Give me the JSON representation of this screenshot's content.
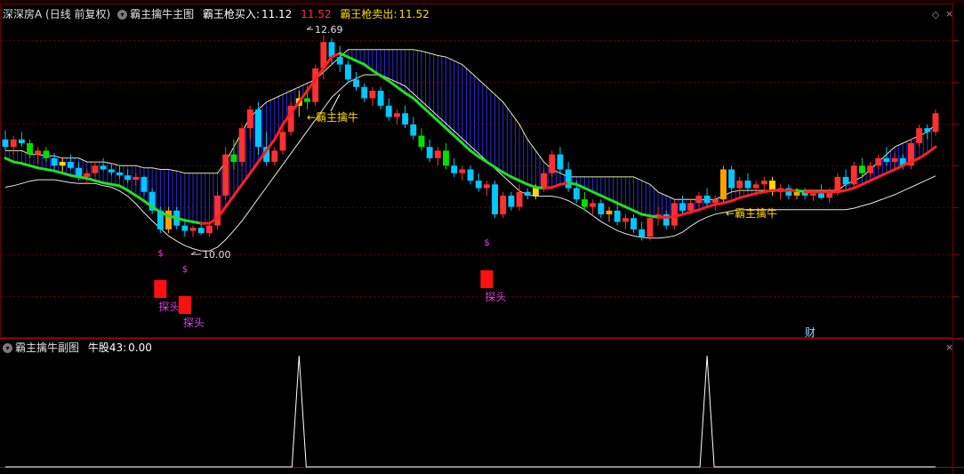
{
  "header": {
    "stock_name": "深深房A",
    "period": "(日线 前复权)",
    "indicator_main": "霸主擒牛主图",
    "buy_label": "霸王枪买入:",
    "buy_value": "11.12",
    "buy_value2": "11.52",
    "sell_label": "霸王枪卖出:",
    "sell_value": "11.52"
  },
  "sub": {
    "indicator": "霸主擒牛副图",
    "label": "牛股43:",
    "value": "0.00"
  },
  "annotations": {
    "high": "12.69",
    "low": "10.00",
    "bull1": "←霸主擒牛",
    "bull2": "←霸主擒牛",
    "probe": "探头",
    "dollar": "$",
    "cai": "财"
  },
  "colors": {
    "up": "#ff3030",
    "down": "#00c8ff",
    "green": "#00e000",
    "yellow": "#ffd700",
    "orange": "#ffa000",
    "magenta": "#e040e0",
    "band": "#3030ff",
    "grid": "#5a0000"
  },
  "chart_data": {
    "type": "candlestick",
    "ylim": [
      9.6,
      12.9
    ],
    "high_mark": 12.69,
    "low_mark": 10.0,
    "buy_price": 11.12,
    "sell_price": 11.52,
    "candles": [
      {
        "o": 11.3,
        "h": 11.42,
        "l": 11.15,
        "c": 11.2
      },
      {
        "o": 11.2,
        "h": 11.35,
        "l": 11.1,
        "c": 11.3
      },
      {
        "o": 11.3,
        "h": 11.4,
        "l": 11.2,
        "c": 11.25
      },
      {
        "o": 11.25,
        "h": 11.3,
        "l": 11.05,
        "c": 11.1
      },
      {
        "o": 11.1,
        "h": 11.2,
        "l": 10.98,
        "c": 11.15
      },
      {
        "o": 11.15,
        "h": 11.2,
        "l": 11.0,
        "c": 11.05
      },
      {
        "o": 11.05,
        "h": 11.12,
        "l": 10.9,
        "c": 10.95
      },
      {
        "o": 10.95,
        "h": 11.05,
        "l": 10.85,
        "c": 11.0
      },
      {
        "o": 11.0,
        "h": 11.1,
        "l": 10.9,
        "c": 10.92
      },
      {
        "o": 10.92,
        "h": 11.0,
        "l": 10.75,
        "c": 10.8
      },
      {
        "o": 10.8,
        "h": 10.9,
        "l": 10.7,
        "c": 10.85
      },
      {
        "o": 10.85,
        "h": 11.0,
        "l": 10.8,
        "c": 10.95
      },
      {
        "o": 10.95,
        "h": 11.05,
        "l": 10.88,
        "c": 10.9
      },
      {
        "o": 10.9,
        "h": 10.98,
        "l": 10.82,
        "c": 10.86
      },
      {
        "o": 10.86,
        "h": 10.95,
        "l": 10.78,
        "c": 10.82
      },
      {
        "o": 10.82,
        "h": 10.9,
        "l": 10.72,
        "c": 10.76
      },
      {
        "o": 10.76,
        "h": 10.85,
        "l": 10.68,
        "c": 10.8
      },
      {
        "o": 10.8,
        "h": 10.82,
        "l": 10.55,
        "c": 10.6
      },
      {
        "o": 10.6,
        "h": 10.65,
        "l": 10.3,
        "c": 10.35
      },
      {
        "o": 10.35,
        "h": 10.4,
        "l": 10.05,
        "c": 10.1
      },
      {
        "o": 10.1,
        "h": 10.4,
        "l": 10.05,
        "c": 10.35
      },
      {
        "o": 10.35,
        "h": 10.4,
        "l": 10.1,
        "c": 10.15
      },
      {
        "o": 10.15,
        "h": 10.2,
        "l": 10.0,
        "c": 10.08
      },
      {
        "o": 10.08,
        "h": 10.15,
        "l": 10.0,
        "c": 10.12
      },
      {
        "o": 10.12,
        "h": 10.2,
        "l": 10.02,
        "c": 10.05
      },
      {
        "o": 10.05,
        "h": 10.18,
        "l": 10.0,
        "c": 10.15
      },
      {
        "o": 10.15,
        "h": 10.6,
        "l": 10.1,
        "c": 10.55
      },
      {
        "o": 10.55,
        "h": 11.2,
        "l": 10.5,
        "c": 11.1
      },
      {
        "o": 11.1,
        "h": 11.3,
        "l": 10.9,
        "c": 11.0
      },
      {
        "o": 11.0,
        "h": 11.5,
        "l": 10.95,
        "c": 11.45
      },
      {
        "o": 11.45,
        "h": 11.75,
        "l": 11.3,
        "c": 11.7
      },
      {
        "o": 11.7,
        "h": 11.8,
        "l": 11.1,
        "c": 11.2
      },
      {
        "o": 11.2,
        "h": 11.4,
        "l": 10.95,
        "c": 11.0
      },
      {
        "o": 11.0,
        "h": 11.2,
        "l": 10.95,
        "c": 11.15
      },
      {
        "o": 11.15,
        "h": 11.5,
        "l": 11.1,
        "c": 11.4
      },
      {
        "o": 11.4,
        "h": 11.8,
        "l": 11.35,
        "c": 11.75
      },
      {
        "o": 11.75,
        "h": 11.95,
        "l": 11.6,
        "c": 11.85
      },
      {
        "o": 11.85,
        "h": 12.0,
        "l": 11.7,
        "c": 11.8
      },
      {
        "o": 11.8,
        "h": 12.3,
        "l": 11.75,
        "c": 12.25
      },
      {
        "o": 12.25,
        "h": 12.69,
        "l": 12.1,
        "c": 12.6
      },
      {
        "o": 12.6,
        "h": 12.65,
        "l": 12.3,
        "c": 12.4
      },
      {
        "o": 12.4,
        "h": 12.55,
        "l": 12.2,
        "c": 12.3
      },
      {
        "o": 12.3,
        "h": 12.35,
        "l": 12.05,
        "c": 12.1
      },
      {
        "o": 12.1,
        "h": 12.2,
        "l": 11.95,
        "c": 12.0
      },
      {
        "o": 12.0,
        "h": 12.05,
        "l": 11.8,
        "c": 11.85
      },
      {
        "o": 11.85,
        "h": 12.0,
        "l": 11.75,
        "c": 11.95
      },
      {
        "o": 11.95,
        "h": 12.0,
        "l": 11.7,
        "c": 11.75
      },
      {
        "o": 11.75,
        "h": 11.85,
        "l": 11.55,
        "c": 11.6
      },
      {
        "o": 11.6,
        "h": 11.7,
        "l": 11.5,
        "c": 11.65
      },
      {
        "o": 11.65,
        "h": 11.75,
        "l": 11.45,
        "c": 11.5
      },
      {
        "o": 11.5,
        "h": 11.6,
        "l": 11.3,
        "c": 11.35
      },
      {
        "o": 11.35,
        "h": 11.45,
        "l": 11.15,
        "c": 11.2
      },
      {
        "o": 11.2,
        "h": 11.3,
        "l": 11.0,
        "c": 11.05
      },
      {
        "o": 11.05,
        "h": 11.2,
        "l": 10.95,
        "c": 11.15
      },
      {
        "o": 11.15,
        "h": 11.25,
        "l": 10.9,
        "c": 10.95
      },
      {
        "o": 10.95,
        "h": 11.05,
        "l": 10.8,
        "c": 10.85
      },
      {
        "o": 10.85,
        "h": 10.95,
        "l": 10.75,
        "c": 10.9
      },
      {
        "o": 10.9,
        "h": 10.95,
        "l": 10.7,
        "c": 10.75
      },
      {
        "o": 10.75,
        "h": 10.85,
        "l": 10.6,
        "c": 10.65
      },
      {
        "o": 10.65,
        "h": 10.75,
        "l": 10.55,
        "c": 10.7
      },
      {
        "o": 10.7,
        "h": 10.75,
        "l": 10.25,
        "c": 10.3
      },
      {
        "o": 10.3,
        "h": 10.6,
        "l": 10.25,
        "c": 10.55
      },
      {
        "o": 10.55,
        "h": 10.6,
        "l": 10.35,
        "c": 10.4
      },
      {
        "o": 10.4,
        "h": 10.7,
        "l": 10.35,
        "c": 10.6
      },
      {
        "o": 10.6,
        "h": 10.65,
        "l": 10.5,
        "c": 10.55
      },
      {
        "o": 10.55,
        "h": 10.7,
        "l": 10.5,
        "c": 10.65
      },
      {
        "o": 10.65,
        "h": 10.9,
        "l": 10.6,
        "c": 10.85
      },
      {
        "o": 10.85,
        "h": 11.15,
        "l": 10.8,
        "c": 11.1
      },
      {
        "o": 11.1,
        "h": 11.2,
        "l": 10.85,
        "c": 10.9
      },
      {
        "o": 10.9,
        "h": 11.0,
        "l": 10.6,
        "c": 10.65
      },
      {
        "o": 10.65,
        "h": 10.75,
        "l": 10.45,
        "c": 10.5
      },
      {
        "o": 10.5,
        "h": 10.6,
        "l": 10.35,
        "c": 10.4
      },
      {
        "o": 10.4,
        "h": 10.5,
        "l": 10.3,
        "c": 10.45
      },
      {
        "o": 10.45,
        "h": 10.5,
        "l": 10.25,
        "c": 10.3
      },
      {
        "o": 10.3,
        "h": 10.4,
        "l": 10.2,
        "c": 10.35
      },
      {
        "o": 10.35,
        "h": 10.45,
        "l": 10.15,
        "c": 10.2
      },
      {
        "o": 10.2,
        "h": 10.3,
        "l": 10.1,
        "c": 10.25
      },
      {
        "o": 10.25,
        "h": 10.3,
        "l": 10.05,
        "c": 10.1
      },
      {
        "o": 10.1,
        "h": 10.2,
        "l": 9.95,
        "c": 10.0
      },
      {
        "o": 10.0,
        "h": 10.3,
        "l": 9.95,
        "c": 10.25
      },
      {
        "o": 10.25,
        "h": 10.4,
        "l": 10.15,
        "c": 10.3
      },
      {
        "o": 10.3,
        "h": 10.35,
        "l": 10.1,
        "c": 10.15
      },
      {
        "o": 10.15,
        "h": 10.5,
        "l": 10.1,
        "c": 10.45
      },
      {
        "o": 10.45,
        "h": 10.55,
        "l": 10.3,
        "c": 10.35
      },
      {
        "o": 10.35,
        "h": 10.5,
        "l": 10.3,
        "c": 10.45
      },
      {
        "o": 10.45,
        "h": 10.6,
        "l": 10.4,
        "c": 10.55
      },
      {
        "o": 10.55,
        "h": 10.65,
        "l": 10.4,
        "c": 10.45
      },
      {
        "o": 10.45,
        "h": 10.55,
        "l": 10.35,
        "c": 10.5
      },
      {
        "o": 10.5,
        "h": 10.95,
        "l": 10.45,
        "c": 10.9
      },
      {
        "o": 10.9,
        "h": 10.95,
        "l": 10.6,
        "c": 10.65
      },
      {
        "o": 10.65,
        "h": 10.8,
        "l": 10.55,
        "c": 10.75
      },
      {
        "o": 10.75,
        "h": 10.85,
        "l": 10.6,
        "c": 10.65
      },
      {
        "o": 10.65,
        "h": 10.75,
        "l": 10.55,
        "c": 10.7
      },
      {
        "o": 10.7,
        "h": 10.8,
        "l": 10.6,
        "c": 10.75
      },
      {
        "o": 10.75,
        "h": 10.8,
        "l": 10.55,
        "c": 10.6
      },
      {
        "o": 10.6,
        "h": 10.7,
        "l": 10.5,
        "c": 10.65
      },
      {
        "o": 10.65,
        "h": 10.7,
        "l": 10.5,
        "c": 10.55
      },
      {
        "o": 10.55,
        "h": 10.65,
        "l": 10.5,
        "c": 10.6
      },
      {
        "o": 10.6,
        "h": 10.65,
        "l": 10.5,
        "c": 10.55
      },
      {
        "o": 10.55,
        "h": 10.62,
        "l": 10.48,
        "c": 10.58
      },
      {
        "o": 10.58,
        "h": 10.7,
        "l": 10.5,
        "c": 10.52
      },
      {
        "o": 10.52,
        "h": 10.65,
        "l": 10.45,
        "c": 10.6
      },
      {
        "o": 10.6,
        "h": 10.85,
        "l": 10.55,
        "c": 10.8
      },
      {
        "o": 10.8,
        "h": 10.9,
        "l": 10.65,
        "c": 10.7
      },
      {
        "o": 10.7,
        "h": 11.0,
        "l": 10.65,
        "c": 10.95
      },
      {
        "o": 10.95,
        "h": 11.05,
        "l": 10.8,
        "c": 10.85
      },
      {
        "o": 10.85,
        "h": 11.0,
        "l": 10.8,
        "c": 10.95
      },
      {
        "o": 10.95,
        "h": 11.1,
        "l": 10.9,
        "c": 11.05
      },
      {
        "o": 11.05,
        "h": 11.2,
        "l": 10.95,
        "c": 11.0
      },
      {
        "o": 11.0,
        "h": 11.12,
        "l": 10.9,
        "c": 11.05
      },
      {
        "o": 11.05,
        "h": 11.1,
        "l": 10.9,
        "c": 10.95
      },
      {
        "o": 10.95,
        "h": 11.3,
        "l": 10.9,
        "c": 11.25
      },
      {
        "o": 11.25,
        "h": 11.5,
        "l": 11.2,
        "c": 11.45
      },
      {
        "o": 11.45,
        "h": 11.5,
        "l": 11.3,
        "c": 11.4
      },
      {
        "o": 11.4,
        "h": 11.7,
        "l": 11.35,
        "c": 11.65
      }
    ],
    "band_upper": [
      11.15,
      11.15,
      11.15,
      11.1,
      11.1,
      11.08,
      11.08,
      11.05,
      11.05,
      11.05,
      11.0,
      11.0,
      11.0,
      10.98,
      10.95,
      10.95,
      10.95,
      10.92,
      10.92,
      10.9,
      10.9,
      10.88,
      10.85,
      10.85,
      10.85,
      10.85,
      10.85,
      11.0,
      11.2,
      11.4,
      11.6,
      11.7,
      11.8,
      11.85,
      11.9,
      11.95,
      12.0,
      12.05,
      12.1,
      12.2,
      12.3,
      12.4,
      12.5,
      12.5,
      12.5,
      12.5,
      12.5,
      12.5,
      12.5,
      12.5,
      12.5,
      12.48,
      12.45,
      12.42,
      12.4,
      12.35,
      12.3,
      12.2,
      12.1,
      12.0,
      11.9,
      11.8,
      11.65,
      11.5,
      11.3,
      11.15,
      11.0,
      10.9,
      10.85,
      10.8,
      10.8,
      10.8,
      10.8,
      10.8,
      10.8,
      10.8,
      10.8,
      10.8,
      10.75,
      10.7,
      10.6,
      10.55,
      10.5,
      10.5,
      10.5,
      10.5,
      10.5,
      10.5,
      10.55,
      10.6,
      10.62,
      10.62,
      10.62,
      10.62,
      10.62,
      10.62,
      10.62,
      10.62,
      10.62,
      10.62,
      10.62,
      10.62,
      10.62,
      10.7,
      10.75,
      10.8,
      10.9,
      11.0,
      11.1,
      11.2,
      11.25,
      11.3,
      11.35,
      11.4,
      11.5
    ],
    "band_lower": [
      11.05,
      11.0,
      10.98,
      10.95,
      10.92,
      10.9,
      10.88,
      10.85,
      10.82,
      10.8,
      10.78,
      10.75,
      10.72,
      10.7,
      10.68,
      10.62,
      10.55,
      10.48,
      10.4,
      10.33,
      10.28,
      10.25,
      10.22,
      10.2,
      10.18,
      10.18,
      10.25,
      10.4,
      10.55,
      10.7,
      10.85,
      11.0,
      11.15,
      11.3,
      11.5,
      11.65,
      11.8,
      11.95,
      12.1,
      12.25,
      12.4,
      12.45,
      12.4,
      12.35,
      12.3,
      12.22,
      12.15,
      12.08,
      12.0,
      11.92,
      11.85,
      11.75,
      11.65,
      11.55,
      11.45,
      11.35,
      11.25,
      11.15,
      11.07,
      11.0,
      10.93,
      10.86,
      10.8,
      10.75,
      10.7,
      10.66,
      10.65,
      10.66,
      10.7,
      10.72,
      10.7,
      10.65,
      10.6,
      10.55,
      10.5,
      10.45,
      10.4,
      10.35,
      10.3,
      10.28,
      10.26,
      10.26,
      10.27,
      10.3,
      10.33,
      10.36,
      10.4,
      10.43,
      10.45,
      10.48,
      10.52,
      10.55,
      10.58,
      10.6,
      10.62,
      10.62,
      10.62,
      10.62,
      10.6,
      10.6,
      10.6,
      10.6,
      10.6,
      10.62,
      10.65,
      10.7,
      10.75,
      10.8,
      10.85,
      10.9,
      10.95,
      11.0,
      11.05,
      11.12,
      11.2
    ],
    "slow_line": [
      10.9,
      10.92,
      10.95,
      10.98,
      11.0,
      11.0,
      11.0,
      10.98,
      10.96,
      10.95,
      10.95,
      10.95,
      10.92,
      10.9,
      10.85,
      10.78,
      10.68,
      10.56,
      10.45,
      10.35,
      10.25,
      10.18,
      10.12,
      10.08,
      10.05,
      10.05,
      10.1,
      10.2,
      10.32,
      10.45,
      10.6,
      10.75,
      10.9,
      11.05,
      11.2,
      11.35,
      11.5,
      11.65,
      11.8,
      11.95,
      12.1,
      12.2,
      12.3,
      12.35,
      12.4,
      12.4,
      12.4,
      12.35,
      12.3,
      12.25,
      12.15,
      12.05,
      11.95,
      11.85,
      11.75,
      11.65,
      11.55,
      11.45,
      11.35,
      11.25,
      11.15,
      11.05,
      10.95,
      10.85,
      10.8,
      10.78,
      10.78,
      10.78,
      10.76,
      10.72,
      10.66,
      10.6,
      10.52,
      10.44,
      10.38,
      10.32,
      10.28,
      10.25,
      10.23,
      10.22,
      10.22,
      10.23,
      10.25,
      10.3,
      10.38,
      10.45,
      10.5,
      10.54,
      10.56,
      10.58,
      10.6,
      10.6,
      10.6,
      10.6,
      10.6,
      10.6,
      10.6,
      10.6,
      10.6,
      10.6,
      10.6,
      10.6,
      10.6,
      10.6,
      10.62,
      10.65,
      10.68,
      10.72,
      10.76,
      10.8,
      10.85,
      10.9,
      10.95,
      11.0,
      11.05
    ],
    "probe_index": [
      19,
      22,
      59
    ],
    "dollar_index": [
      19,
      22,
      59
    ],
    "sub_signal_index": [
      36,
      86
    ],
    "sub_ylim": [
      0,
      1
    ],
    "sub_series_name": "牛股43"
  }
}
